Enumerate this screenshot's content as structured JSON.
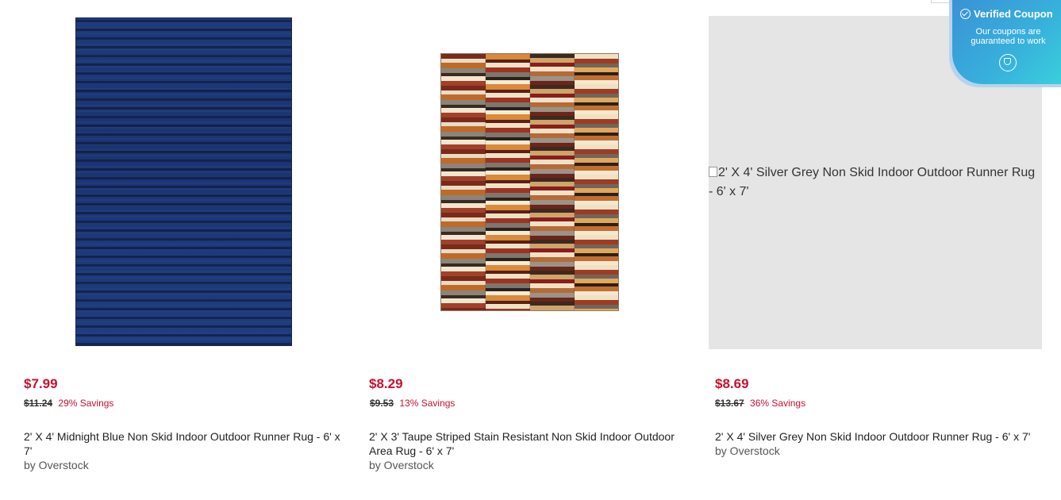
{
  "products": [
    {
      "price": "$7.99",
      "old_price": "$11.24",
      "savings": "29% Savings",
      "title": "2' X 4' Midnight Blue Non Skid Indoor Outdoor Runner Rug - 6' x 7'",
      "seller": "by Overstock",
      "image": "midnight-blue-rug"
    },
    {
      "price": "$8.29",
      "old_price": "$9.53",
      "savings": "13% Savings",
      "title": "2' X 3' Taupe Striped Stain Resistant Non Skid Indoor Outdoor Area Rug - 6' x 7'",
      "seller": "by Overstock",
      "image": "taupe-striped-rug"
    },
    {
      "price": "$8.69",
      "old_price": "$13.67",
      "savings": "36% Savings",
      "title": "2' X 4' Silver Grey Non Skid Indoor Outdoor Runner Rug - 6' x 7'",
      "seller": "by Overstock",
      "image_alt": "2' X 4' Silver Grey Non Skid Indoor Outdoor Runner Rug - 6' x 7'"
    }
  ],
  "coupon_badge": {
    "title": "Verified Coupon",
    "subtitle": "Our coupons are guaranteed to work",
    "icons": [
      "check-circle-icon",
      "shield-icon"
    ]
  },
  "colors": {
    "price_red": "#c8102e",
    "badge_gradient_start": "#3a8fd6",
    "badge_gradient_end": "#3cd3dc",
    "placeholder_gray": "#e5e5e5"
  }
}
